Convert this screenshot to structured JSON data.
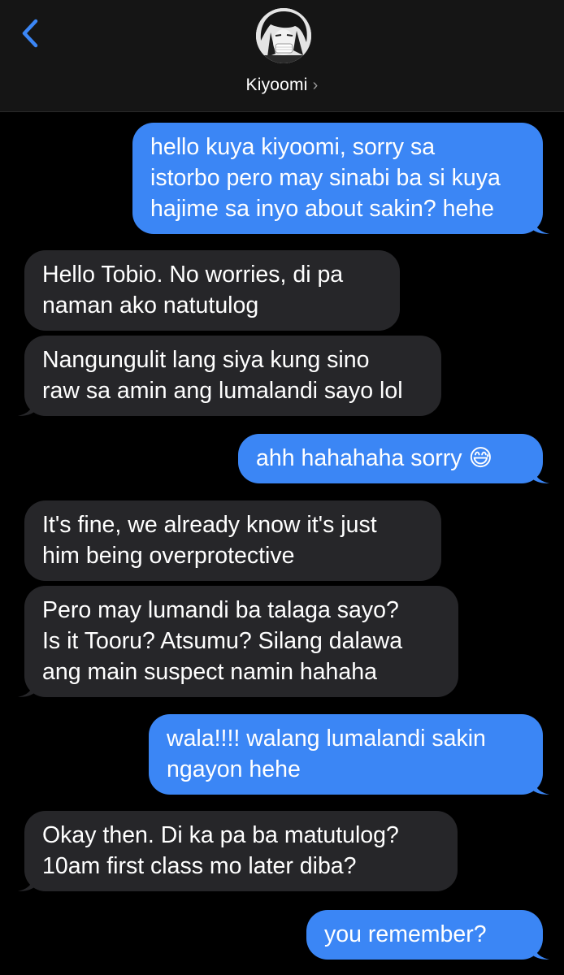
{
  "header": {
    "back_icon": "chevron-left-icon",
    "contact_name": "Kiyoomi",
    "chevron": "›",
    "accent": "#3b86f5"
  },
  "colors": {
    "sent": "#3b86f5",
    "received": "#262629",
    "background": "#000000"
  },
  "messages": [
    {
      "dir": "sent",
      "text": "hello kuya kiyoomi, sorry sa\nistorbo pero may sinabi ba si kuya\nhajime sa inyo about sakin? hehe"
    },
    {
      "dir": "received",
      "text": "Hello Tobio. No worries, di pa\nnaman ako natutulog"
    },
    {
      "dir": "received",
      "text": "Nangungulit lang siya kung sino\nraw sa amin ang lumalandi sayo lol"
    },
    {
      "dir": "sent",
      "text": "ahh hahahaha sorry 😅"
    },
    {
      "dir": "received",
      "text": "It's fine, we already know it's just\nhim being overprotective"
    },
    {
      "dir": "received",
      "text": "Pero may lumandi ba talaga sayo?\nIs it Tooru? Atsumu? Silang dalawa\nang main suspect namin hahaha"
    },
    {
      "dir": "sent",
      "text": "wala!!!! walang lumalandi sakin\nngayon hehe"
    },
    {
      "dir": "received",
      "text": "Okay then. Di ka pa ba matutulog?\n10am first class mo later diba?"
    },
    {
      "dir": "sent",
      "text": "you remember?"
    }
  ]
}
